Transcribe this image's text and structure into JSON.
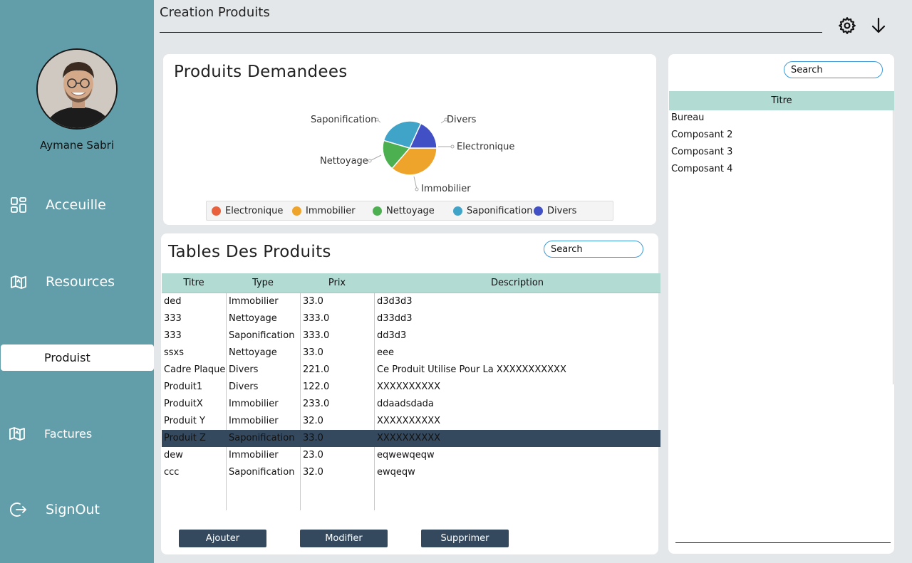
{
  "user": {
    "name": "Aymane Sabri"
  },
  "nav": [
    {
      "label": "Acceuille",
      "icon": "grid-icon"
    },
    {
      "label": "Resources",
      "icon": "map-icon"
    },
    {
      "label": "Produist",
      "icon": "",
      "active": true
    },
    {
      "label": "Factures",
      "icon": "map-icon"
    },
    {
      "label": "SignOut",
      "icon": "signout-icon"
    }
  ],
  "header": {
    "title": "Creation Produits",
    "icons": [
      "gear-icon",
      "arrow-down-icon"
    ]
  },
  "pie_card": {
    "title": "Produits Demandees",
    "labels": [
      "Saponification",
      "Divers",
      "Electronique",
      "Nettoyage",
      "Immobilier"
    ]
  },
  "chart_data": {
    "type": "pie",
    "title": "Produits Demandees",
    "slices": [
      {
        "name": "Electronique",
        "value": 0.0,
        "color": "#e8603c"
      },
      {
        "name": "Immobilier",
        "value": 36.4,
        "color": "#eea32a"
      },
      {
        "name": "Nettoyage",
        "value": 18.2,
        "color": "#4caf50"
      },
      {
        "name": "Saponification",
        "value": 27.3,
        "color": "#40a3c8"
      },
      {
        "name": "Divers",
        "value": 18.2,
        "color": "#4250c5"
      }
    ],
    "legend": [
      "Electronique",
      "Immobilier",
      "Nettoyage",
      "Saponification",
      "Divers"
    ],
    "legend_position": "bottom"
  },
  "table_card": {
    "title": "Tables Des Produits",
    "search_placeholder": "Search",
    "columns": [
      "Titre",
      "Type",
      "Prix",
      "Description"
    ],
    "rows": [
      [
        "ded",
        "Immobilier",
        "33.0",
        "d3d3d3"
      ],
      [
        "333",
        "Nettoyage",
        "333.0",
        "d33dd3"
      ],
      [
        "333",
        "Saponification",
        "333.0",
        "dd3d3"
      ],
      [
        "ssxs",
        "Nettoyage",
        "33.0",
        "eee"
      ],
      [
        "Cadre Plaque",
        "Divers",
        "221.0",
        "Ce Produit Utilise Pour La XXXXXXXXXXX"
      ],
      [
        "Produit1",
        "Divers",
        "122.0",
        "XXXXXXXXXX"
      ],
      [
        "ProduitX",
        "Immobilier",
        "233.0",
        "ddaadsdada"
      ],
      [
        "Produit Y",
        "Immobilier",
        "32.0",
        "XXXXXXXXXX"
      ],
      [
        "Produit Z",
        "Saponification",
        "33.0",
        "XXXXXXXXXX"
      ],
      [
        "dew",
        "Immobilier",
        "23.0",
        "eqwewqeqw"
      ],
      [
        "ccc",
        "Saponification",
        "32.0",
        "ewqeqw"
      ]
    ],
    "selected_row": 8,
    "buttons": {
      "add": "Ajouter",
      "edit": "Modifier",
      "delete": "Supprimer"
    }
  },
  "right_panel": {
    "search_placeholder": "Search",
    "column": "Titre",
    "items": [
      "Bureau",
      "Composant 2",
      "Composant 3",
      "Composant 4"
    ]
  },
  "colors": {
    "sidebar": "#629ea9",
    "header_row": "#b2dbd4",
    "button": "#34495e",
    "selected_row": "#34495e",
    "search_border": "#3d9ad6"
  }
}
